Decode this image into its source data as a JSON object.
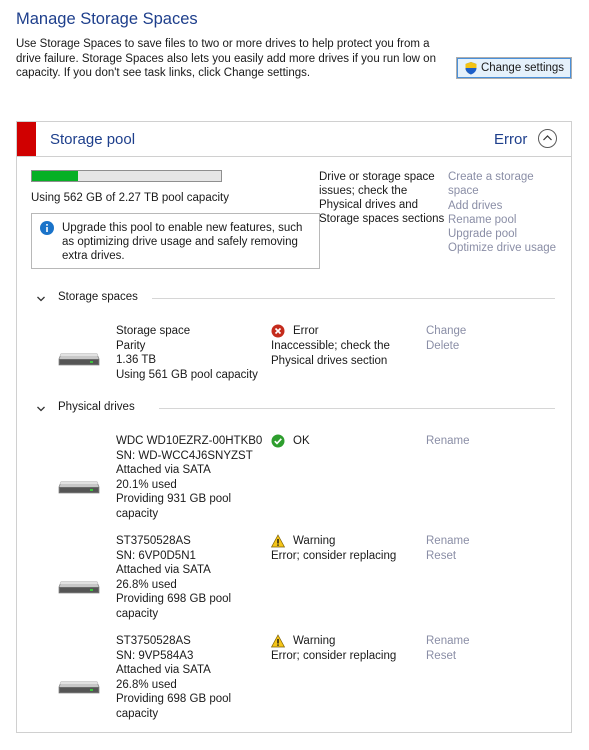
{
  "page": {
    "title": "Manage Storage Spaces",
    "intro": "Use Storage Spaces to save files to two or more drives to help protect you from a drive failure. Storage Spaces also lets you easily add more drives if you run low on capacity. If you don't see task links, click Change settings.",
    "change_settings": "Change settings"
  },
  "pool": {
    "title": "Storage pool",
    "status": "Error",
    "usage_percent": 24.2,
    "capacity_text": "Using 562 GB of 2.27 TB pool capacity",
    "info_text": "Upgrade this pool to enable new features, such as optimizing drive usage and safely removing extra drives.",
    "message": "Drive or storage space issues; check the Physical drives and Storage spaces sections",
    "links": [
      "Create a storage space",
      "Add drives",
      "Rename pool",
      "Upgrade pool",
      "Optimize drive usage"
    ]
  },
  "storage_spaces": {
    "heading": "Storage spaces",
    "items": [
      {
        "lines": [
          "Storage space",
          "Parity",
          "1.36 TB",
          "Using 561 GB pool capacity"
        ],
        "status_icon": "error-icon",
        "status_title": "Error",
        "status_detail": "Inaccessible; check the Physical drives section",
        "links": [
          "Change",
          "Delete"
        ]
      }
    ]
  },
  "physical_drives": {
    "heading": "Physical drives",
    "items": [
      {
        "lines": [
          "WDC WD10EZRZ-00HTKB0",
          "SN: WD-WCC4J6SNYZST",
          "Attached via SATA",
          "20.1% used",
          "Providing 931 GB pool",
          "capacity"
        ],
        "status_icon": "ok-icon",
        "status_title": "OK",
        "status_detail": "",
        "links": [
          "Rename"
        ]
      },
      {
        "lines": [
          "ST3750528AS",
          "SN: 6VP0D5N1",
          "Attached via SATA",
          "26.8% used",
          "Providing 698 GB pool",
          "capacity"
        ],
        "status_icon": "warning-icon",
        "status_title": "Warning",
        "status_detail": "Error; consider replacing",
        "links": [
          "Rename",
          "Reset"
        ]
      },
      {
        "lines": [
          "ST3750528AS",
          "SN: 9VP584A3",
          "Attached via SATA",
          "26.8% used",
          "Providing 698 GB pool",
          "capacity"
        ],
        "status_icon": "warning-icon",
        "status_title": "Warning",
        "status_detail": "Error; consider replacing",
        "links": [
          "Rename",
          "Reset"
        ]
      }
    ]
  },
  "colors": {
    "title_blue": "#1e3f8c",
    "error_red": "#d00000",
    "progress_green": "#06b025",
    "link_gray": "#8a8ea6"
  }
}
